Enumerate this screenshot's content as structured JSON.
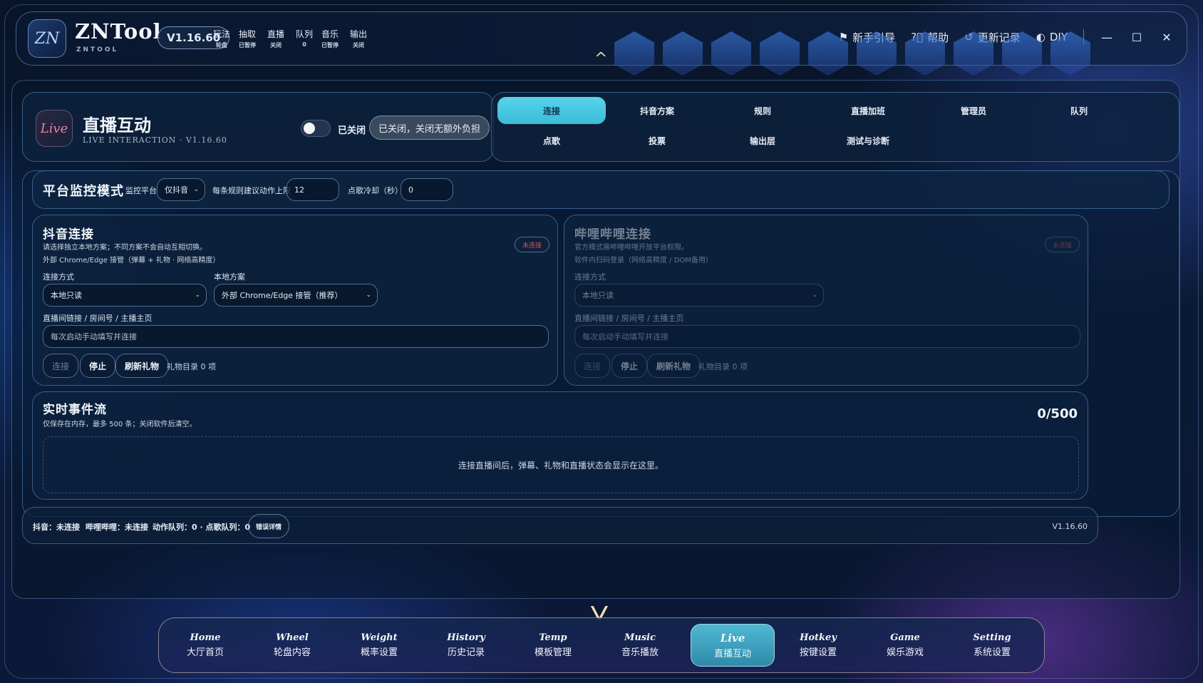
{
  "app": {
    "logo": "ZN",
    "name": "ZNTool",
    "subtitle": "ZNTOOL",
    "version": "V1.16.60"
  },
  "status_items": [
    {
      "label": "玩法",
      "value": "轮盘"
    },
    {
      "label": "抽取",
      "value": "已暂停"
    },
    {
      "label": "直播",
      "value": "关闭"
    },
    {
      "label": "队列",
      "value": "0"
    },
    {
      "label": "音乐",
      "value": "已暂停"
    },
    {
      "label": "输出",
      "value": "关闭"
    }
  ],
  "top_actions": [
    {
      "label": "新手引导",
      "icon": "guide-icon"
    },
    {
      "label": "帮助",
      "icon": "help-icon"
    },
    {
      "label": "更新记录",
      "icon": "history-icon"
    },
    {
      "label": "DIY",
      "icon": "palette-icon"
    }
  ],
  "window_controls": {
    "minimize": "—",
    "maximize": "☐",
    "close": "✕"
  },
  "live": {
    "logo": "Live",
    "title": "直播互动",
    "subtitle": "LIVE INTERACTION · V1.16.60",
    "toggle_label": "已关闭",
    "state_pill": "已关闭，关闭无额外负担",
    "toggle_on": false
  },
  "tabs": [
    {
      "label": "连接",
      "active": true
    },
    {
      "label": "抖音方案"
    },
    {
      "label": "规则"
    },
    {
      "label": "直播加班"
    },
    {
      "label": "管理员"
    },
    {
      "label": "队列"
    },
    {
      "label": "点歌"
    },
    {
      "label": "投票"
    },
    {
      "label": "输出层"
    },
    {
      "label": "测试与诊断"
    }
  ],
  "monitor": {
    "title": "平台监控模式",
    "platform_label": "监控平台",
    "platform_value": "仅抖音",
    "limit_label": "每条规则建议动作上限",
    "limit_value": "12",
    "cooldown_label": "点歌冷却（秒）",
    "cooldown_value": "0"
  },
  "douyin": {
    "title": "抖音连接",
    "desc1": "请选择独立本地方案；不同方案不会自动互相切换。",
    "desc2": "外部 Chrome/Edge 接管（弹幕 + 礼物 · 网络高精度）",
    "badge": "未连接",
    "method_label": "连接方式",
    "method_value": "本地只读",
    "scheme_label": "本地方案",
    "scheme_value": "外部 Chrome/Edge 接管（推荐）",
    "room_label": "直播间链接 / 房间号 / 主播主页",
    "room_placeholder": "每次启动手动填写并连接",
    "btn_connect": "连接",
    "btn_stop": "停止",
    "btn_refresh": "刷新礼物",
    "gift_count": "礼物目录 0 项"
  },
  "bilibili": {
    "title": "哔哩哔哩连接",
    "desc1": "官方模式需哔哩哔哩开放平台权限。",
    "desc2": "软件内扫码登录（网络高精度 / DOM备用）",
    "badge": "未连接",
    "method_label": "连接方式",
    "method_value": "本地只读",
    "room_label": "直播间链接 / 房间号 / 主播主页",
    "room_placeholder": "每次启动手动填写并连接",
    "btn_connect": "连接",
    "btn_stop": "停止",
    "btn_refresh": "刷新礼物",
    "gift_count": "礼物目录 0 项"
  },
  "events": {
    "title": "实时事件流",
    "desc": "仅保存在内存，最多 500 条；关闭软件后清空。",
    "count": "0/500",
    "empty": "连接直播间后，弹幕、礼物和直播状态会显示在这里。"
  },
  "statusbar": {
    "douyin": "抖音：未连接",
    "bilibili": "哔哩哔哩：未连接",
    "queues": "动作队列：0 · 点歌队列：0",
    "error_btn": "错误详情",
    "version": "V1.16.60"
  },
  "nav": [
    {
      "en": "Home",
      "cn": "大厅首页"
    },
    {
      "en": "Wheel",
      "cn": "轮盘内容"
    },
    {
      "en": "Weight",
      "cn": "概率设置"
    },
    {
      "en": "History",
      "cn": "历史记录"
    },
    {
      "en": "Temp",
      "cn": "模板管理"
    },
    {
      "en": "Music",
      "cn": "音乐播放"
    },
    {
      "en": "Live",
      "cn": "直播互动",
      "active": true
    },
    {
      "en": "Hotkey",
      "cn": "按键设置"
    },
    {
      "en": "Game",
      "cn": "娱乐游戏"
    },
    {
      "en": "Setting",
      "cn": "系统设置"
    }
  ],
  "colors": {
    "accent": "#4fc8e0",
    "badge_red": "#d4505a",
    "bg": "#0a1a34"
  }
}
